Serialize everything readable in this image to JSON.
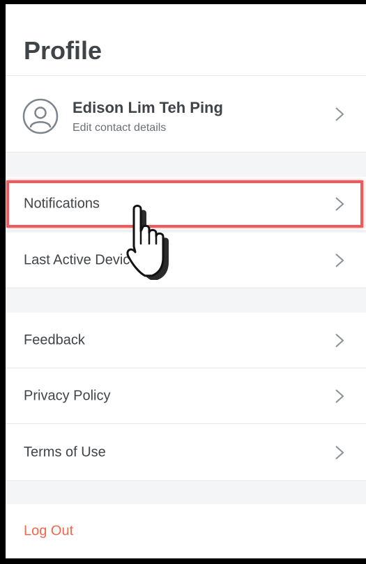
{
  "header": {
    "title": "Profile"
  },
  "profile": {
    "name": "Edison Lim Teh Ping",
    "subtitle": "Edit contact details",
    "avatar_icon": "user-avatar-icon"
  },
  "menu": {
    "notifications": "Notifications",
    "last_active_device": "Last Active Device",
    "feedback": "Feedback",
    "privacy_policy": "Privacy Policy",
    "terms_of_use": "Terms of Use",
    "log_out": "Log Out"
  },
  "icons": {
    "chevron": "chevron-right-icon",
    "pointer": "hand-pointer-icon"
  },
  "colors": {
    "background": "#f4f5f7",
    "text": "#3f4448",
    "logout": "#f0684b",
    "highlight": "#f05a5a"
  }
}
